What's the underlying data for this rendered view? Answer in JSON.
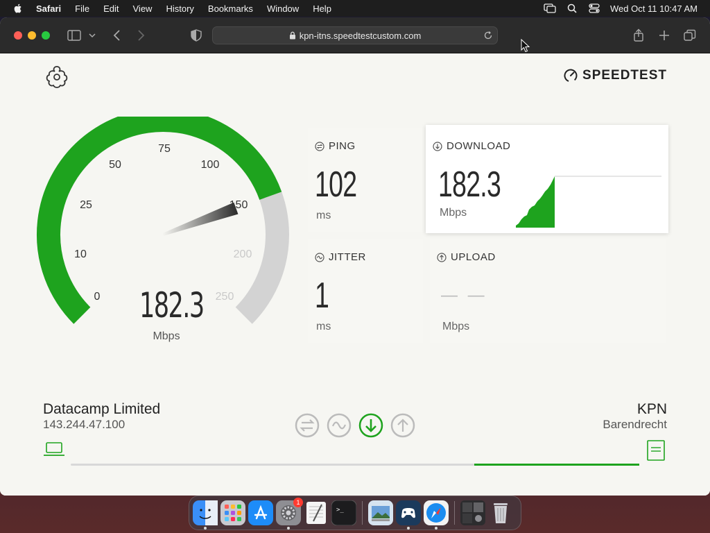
{
  "menubar": {
    "app_name": "Safari",
    "items": [
      "File",
      "Edit",
      "View",
      "History",
      "Bookmarks",
      "Window",
      "Help"
    ],
    "clock": "Wed Oct 11  10:47 AM",
    "icons": [
      "screen-mirroring-icon",
      "spotlight-search-icon",
      "control-center-icon"
    ]
  },
  "browser": {
    "url": "kpn-itns.speedtestcustom.com",
    "icons": [
      "sidebar-icon",
      "chevron-down-icon",
      "back-icon",
      "forward-icon",
      "shield-icon",
      "lock-icon",
      "reload-icon",
      "share-icon",
      "new-tab-icon",
      "tab-overview-icon"
    ]
  },
  "page": {
    "brand": "SPEEDTEST",
    "gauge": {
      "value": "182.3",
      "unit": "Mbps",
      "ticks": [
        "0",
        "10",
        "25",
        "50",
        "75",
        "100",
        "150",
        "200",
        "250"
      ],
      "fill_fraction": 0.76,
      "colors": {
        "active": "#1ea31e",
        "inactive": "#d3d3d3"
      }
    },
    "metrics": {
      "ping": {
        "label": "PING",
        "value": "102",
        "unit": "ms"
      },
      "jitter": {
        "label": "JITTER",
        "value": "1",
        "unit": "ms"
      },
      "download": {
        "label": "DOWNLOAD",
        "value": "182.3",
        "unit": "Mbps"
      },
      "upload": {
        "label": "UPLOAD",
        "value": "— —",
        "unit": "Mbps"
      }
    },
    "client": {
      "name": "Datacamp Limited",
      "ip": "143.244.47.100"
    },
    "server": {
      "name": "KPN",
      "location": "Barendrecht"
    },
    "progress_fraction": 0.29,
    "accent_color": "#1ea31e"
  },
  "dock": {
    "apps": [
      "Finder",
      "Launchpad",
      "App Store",
      "System Settings",
      "TextEdit",
      "Terminal",
      "Preview",
      "Steam Link",
      "Safari",
      "Recent Documents",
      "Trash"
    ],
    "settings_badge": "1"
  }
}
